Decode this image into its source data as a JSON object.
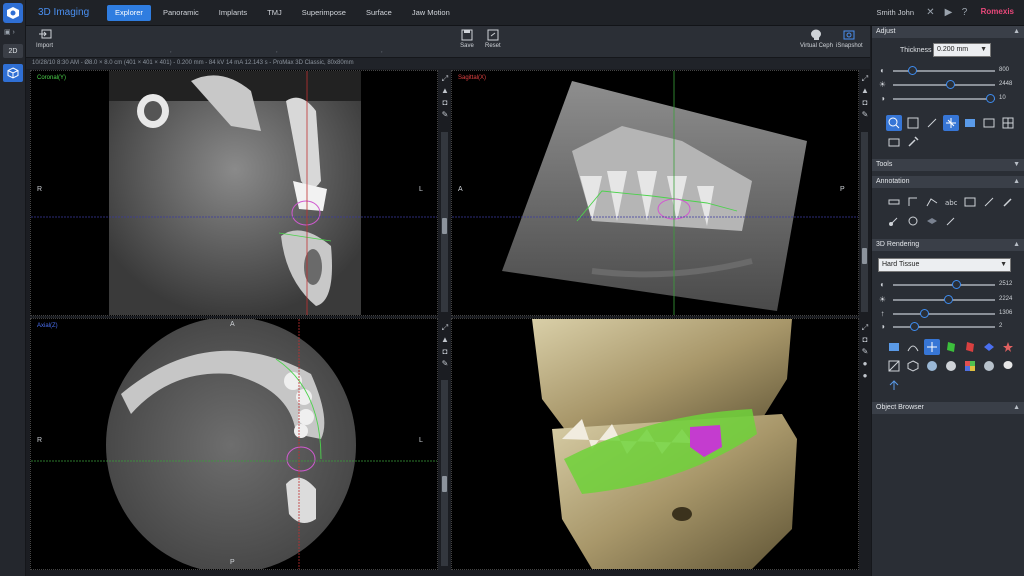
{
  "app": {
    "title": "3D Imaging",
    "brand": "Romexis",
    "user": "Smith John"
  },
  "leftstrip": {
    "btn2d": "2D"
  },
  "tabs": [
    "Explorer",
    "Panoramic",
    "Implants",
    "TMJ",
    "Superimpose",
    "Surface",
    "Jaw Motion"
  ],
  "toolbar": {
    "import": "Import",
    "save": "Save",
    "reset": "Reset",
    "virtual_ceph": "Virtual Ceph",
    "isnapshot": "iSnapshot"
  },
  "info_line": "10/28/10 8:30 AM - Ø8.0 × 8.0 cm (401 × 401 × 401) - 0.200 mm - 84 kV 14 mA 12.143 s - ProMax 3D Classic, 80x80mm",
  "viewports": {
    "coronal": {
      "label": "Coronal(Y)",
      "left": "R",
      "right": "L",
      "color": "#4cd24c"
    },
    "sagittal": {
      "label": "Sagittal(X)",
      "left": "A",
      "right": "P",
      "color": "#e04040"
    },
    "axial": {
      "label": "Axial(Z)",
      "left": "R",
      "right": "L",
      "top": "A",
      "bottom": "P",
      "color": "#4a6ff0"
    }
  },
  "panel": {
    "adjust": {
      "title": "Adjust",
      "thickness_label": "Thickness",
      "thickness_value": "0.200 mm",
      "sliders": [
        {
          "icon": "contrast-icon",
          "value": "800"
        },
        {
          "icon": "brightness-icon",
          "value": "2448"
        },
        {
          "icon": "gamma-icon",
          "value": "10"
        }
      ]
    },
    "tools": {
      "title": "Tools"
    },
    "annotation": {
      "title": "Annotation"
    },
    "rendering": {
      "title": "3D Rendering",
      "preset": "Hard Tissue",
      "sliders": [
        {
          "icon": "contrast-icon",
          "value": "2512"
        },
        {
          "icon": "brightness-icon",
          "value": "2224"
        },
        {
          "icon": "threshold-icon",
          "value": "1306"
        },
        {
          "icon": "opacity-icon",
          "value": "2"
        }
      ]
    },
    "object_browser": {
      "title": "Object Browser"
    }
  }
}
